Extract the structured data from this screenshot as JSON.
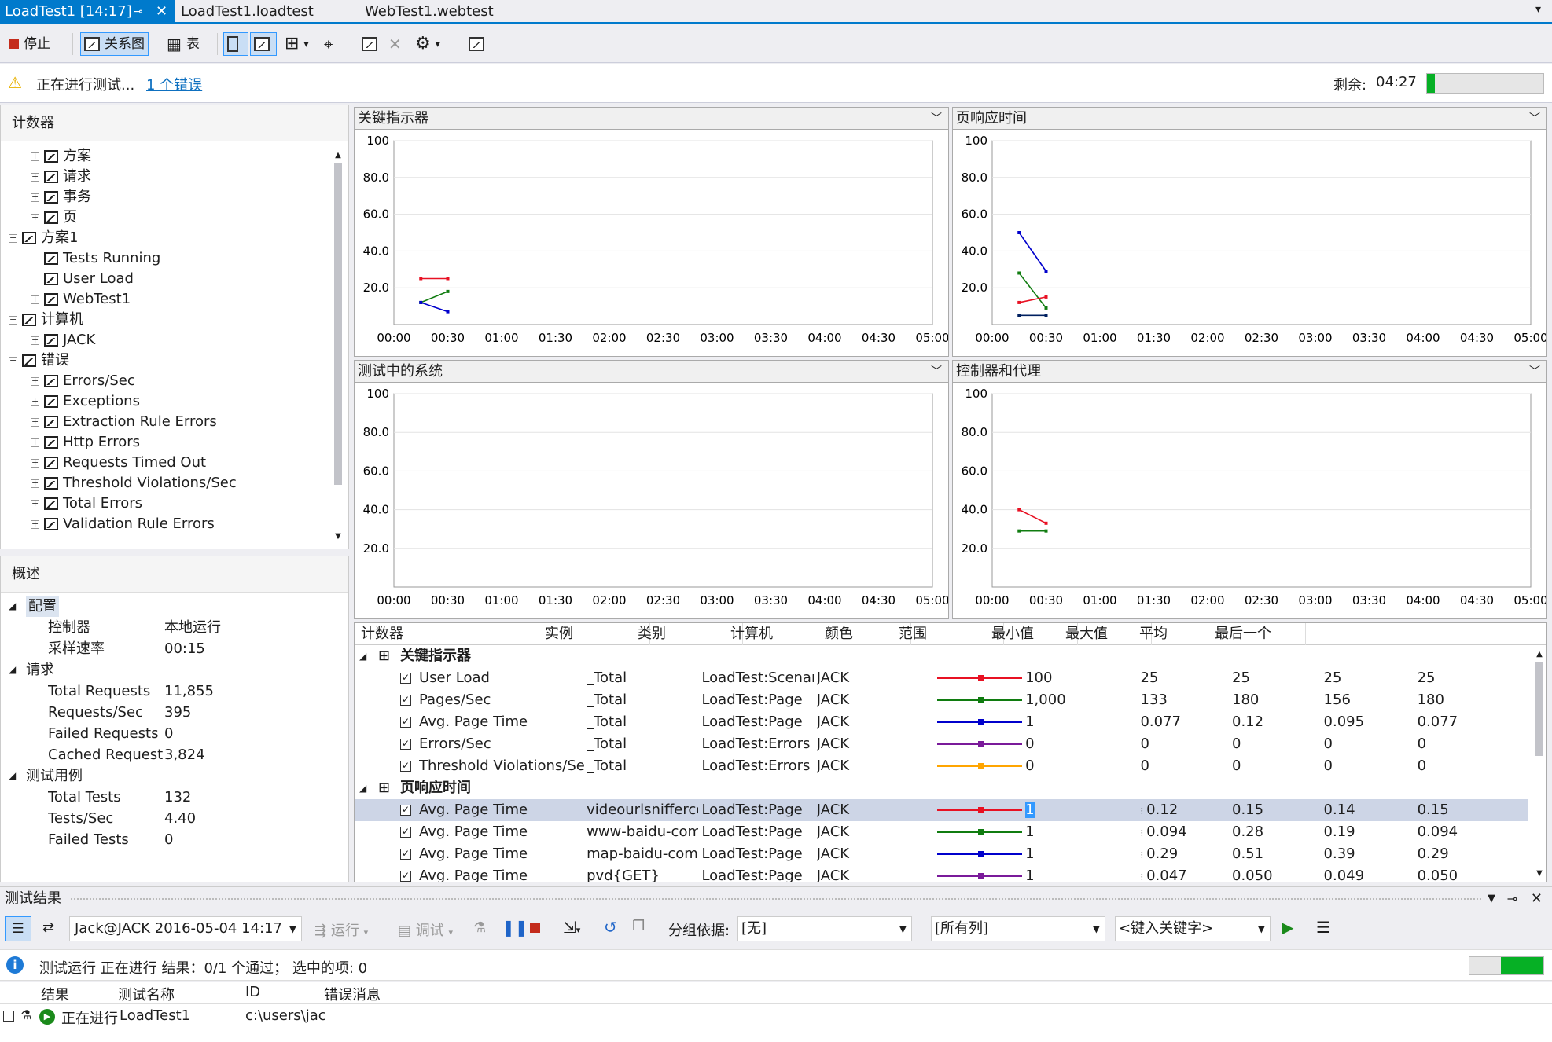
{
  "tabs": [
    {
      "label": "LoadTest1 [14:17]"
    },
    {
      "label": "LoadTest1.loadtest"
    },
    {
      "label": "WebTest1.webtest"
    }
  ],
  "toolbar": {
    "stop_label": "停止",
    "graph_label": "关系图",
    "table_label": "表"
  },
  "status": {
    "running_text": "正在进行测试...",
    "errors_link": "1 个错误",
    "remaining_label": "剩余:",
    "remaining_value": "04:27",
    "progress": 0.07
  },
  "counters": {
    "title": "计数器",
    "items": [
      {
        "label": "方案",
        "level": 1,
        "expander": "plus"
      },
      {
        "label": "请求",
        "level": 1,
        "expander": "plus"
      },
      {
        "label": "事务",
        "level": 1,
        "expander": "plus"
      },
      {
        "label": "页",
        "level": 1,
        "expander": "plus"
      },
      {
        "label": "方案1",
        "level": 0,
        "expander": "minus"
      },
      {
        "label": "Tests Running",
        "level": 1,
        "expander": "none"
      },
      {
        "label": "User Load",
        "level": 1,
        "expander": "none"
      },
      {
        "label": "WebTest1",
        "level": 1,
        "expander": "plus"
      },
      {
        "label": "计算机",
        "level": 0,
        "expander": "minus"
      },
      {
        "label": "JACK",
        "level": 1,
        "expander": "plus"
      },
      {
        "label": "错误",
        "level": 0,
        "expander": "minus"
      },
      {
        "label": "Errors/Sec",
        "level": 1,
        "expander": "plus"
      },
      {
        "label": "Exceptions",
        "level": 1,
        "expander": "plus"
      },
      {
        "label": "Extraction Rule Errors",
        "level": 1,
        "expander": "plus"
      },
      {
        "label": "Http Errors",
        "level": 1,
        "expander": "plus"
      },
      {
        "label": "Requests Timed Out",
        "level": 1,
        "expander": "plus"
      },
      {
        "label": "Threshold Violations/Sec",
        "level": 1,
        "expander": "plus"
      },
      {
        "label": "Total Errors",
        "level": 1,
        "expander": "plus"
      },
      {
        "label": "Validation Rule Errors",
        "level": 1,
        "expander": "plus"
      }
    ]
  },
  "overview": {
    "title": "概述",
    "rows": [
      {
        "type": "group",
        "label": "配置"
      },
      {
        "type": "item",
        "label": "控制器",
        "value": "本地运行"
      },
      {
        "type": "item",
        "label": "采样速率",
        "value": "00:15"
      },
      {
        "type": "group",
        "label": "请求"
      },
      {
        "type": "item",
        "label": "Total Requests",
        "value": "11,855"
      },
      {
        "type": "item",
        "label": "Requests/Sec",
        "value": "395"
      },
      {
        "type": "item",
        "label": "Failed Requests",
        "value": "0"
      },
      {
        "type": "item",
        "label": "Cached Requests",
        "value": "3,824"
      },
      {
        "type": "group",
        "label": "测试用例"
      },
      {
        "type": "item",
        "label": "Total Tests",
        "value": "132"
      },
      {
        "type": "item",
        "label": "Tests/Sec",
        "value": "4.40"
      },
      {
        "type": "item",
        "label": "Failed Tests",
        "value": "0"
      }
    ]
  },
  "chart_data": [
    {
      "type": "line",
      "title": "关键指示器",
      "ylim": [
        0,
        100
      ],
      "yticks": [
        "100",
        "80.0",
        "60.0",
        "40.0",
        "20.0"
      ],
      "x": [
        "00:00",
        "00:30",
        "01:00",
        "01:30",
        "02:00",
        "02:30",
        "03:00",
        "03:30",
        "04:00",
        "04:30",
        "05:00"
      ],
      "series": [
        {
          "color": "#e81123",
          "points": [
            [
              15,
              25
            ],
            [
              30,
              25
            ]
          ]
        },
        {
          "color": "#107c10",
          "points": [
            [
              15,
              12
            ],
            [
              30,
              18
            ]
          ]
        },
        {
          "color": "#0000cc",
          "points": [
            [
              15,
              12
            ],
            [
              30,
              7
            ]
          ]
        }
      ]
    },
    {
      "type": "line",
      "title": "页响应时间",
      "ylim": [
        0,
        100
      ],
      "yticks": [
        "100",
        "80.0",
        "60.0",
        "40.0",
        "20.0"
      ],
      "x": [
        "00:00",
        "00:30",
        "01:00",
        "01:30",
        "02:00",
        "02:30",
        "03:00",
        "03:30",
        "04:00",
        "04:30",
        "05:00"
      ],
      "series": [
        {
          "color": "#0000cc",
          "points": [
            [
              15,
              50
            ],
            [
              30,
              29
            ]
          ]
        },
        {
          "color": "#107c10",
          "points": [
            [
              15,
              28
            ],
            [
              30,
              9
            ]
          ]
        },
        {
          "color": "#e81123",
          "points": [
            [
              15,
              12
            ],
            [
              30,
              15
            ]
          ]
        },
        {
          "color": "#002060",
          "points": [
            [
              15,
              5
            ],
            [
              30,
              5
            ]
          ]
        }
      ]
    },
    {
      "type": "line",
      "title": "测试中的系统",
      "ylim": [
        0,
        100
      ],
      "yticks": [
        "100",
        "80.0",
        "60.0",
        "40.0",
        "20.0"
      ],
      "x": [
        "00:00",
        "00:30",
        "01:00",
        "01:30",
        "02:00",
        "02:30",
        "03:00",
        "03:30",
        "04:00",
        "04:30",
        "05:00"
      ],
      "series": []
    },
    {
      "type": "line",
      "title": "控制器和代理",
      "ylim": [
        0,
        100
      ],
      "yticks": [
        "100",
        "80.0",
        "60.0",
        "40.0",
        "20.0"
      ],
      "x": [
        "00:00",
        "00:30",
        "01:00",
        "01:30",
        "02:00",
        "02:30",
        "03:00",
        "03:30",
        "04:00",
        "04:30",
        "05:00"
      ],
      "series": [
        {
          "color": "#e81123",
          "points": [
            [
              15,
              40
            ],
            [
              30,
              33
            ]
          ]
        },
        {
          "color": "#107c10",
          "points": [
            [
              15,
              29
            ],
            [
              30,
              29
            ]
          ]
        }
      ]
    }
  ],
  "grid": {
    "headers": [
      "计数器",
      "实例",
      "类别",
      "计算机",
      "颜色",
      "范围",
      "最小值",
      "最大值",
      "平均",
      "最后一个"
    ],
    "groups": [
      {
        "title": "关键指示器",
        "rows": [
          {
            "counter": "User Load",
            "instance": "_Total",
            "category": "LoadTest:Scenario",
            "computer": "JACK",
            "color": "#e81123",
            "range": "100",
            "min": "25",
            "max": "25",
            "avg": "25",
            "last": "25"
          },
          {
            "counter": "Pages/Sec",
            "instance": "_Total",
            "category": "LoadTest:Page",
            "computer": "JACK",
            "color": "#107c10",
            "range": "1,000",
            "min": "133",
            "max": "180",
            "avg": "156",
            "last": "180"
          },
          {
            "counter": "Avg. Page Time",
            "instance": "_Total",
            "category": "LoadTest:Page",
            "computer": "JACK",
            "color": "#0000cc",
            "range": "1",
            "min": "0.077",
            "max": "0.12",
            "avg": "0.095",
            "last": "0.077"
          },
          {
            "counter": "Errors/Sec",
            "instance": "_Total",
            "category": "LoadTest:Errors",
            "computer": "JACK",
            "color": "#7a1a9a",
            "range": "0",
            "min": "0",
            "max": "0",
            "avg": "0",
            "last": "0"
          },
          {
            "counter": "Threshold Violations/Sec",
            "instance": "_Total",
            "category": "LoadTest:Errors",
            "computer": "JACK",
            "color": "#ffa500",
            "range": "0",
            "min": "0",
            "max": "0",
            "avg": "0",
            "last": "0"
          }
        ]
      },
      {
        "title": "页响应时间",
        "rows": [
          {
            "counter": "Avg. Page Time",
            "instance": "videourlsniffercom",
            "category": "LoadTest:Page",
            "computer": "JACK",
            "color": "#e81123",
            "range": "1",
            "min": "0.12",
            "max": "0.15",
            "avg": "0.14",
            "last": "0.15",
            "selected": true
          },
          {
            "counter": "Avg. Page Time",
            "instance": "www-baidu-com",
            "category": "LoadTest:Page",
            "computer": "JACK",
            "color": "#107c10",
            "range": "1",
            "min": "0.094",
            "max": "0.28",
            "avg": "0.19",
            "last": "0.094"
          },
          {
            "counter": "Avg. Page Time",
            "instance": "map-baidu-com",
            "category": "LoadTest:Page",
            "computer": "JACK",
            "color": "#0000cc",
            "range": "1",
            "min": "0.29",
            "max": "0.51",
            "avg": "0.39",
            "last": "0.29"
          },
          {
            "counter": "Avg. Page Time",
            "instance": "pvd{GET}",
            "category": "LoadTest:Page",
            "computer": "JACK",
            "color": "#7a1a9a",
            "range": "1",
            "min": "0.047",
            "max": "0.050",
            "avg": "0.049",
            "last": "0.050"
          }
        ]
      }
    ]
  },
  "results": {
    "title": "测试结果",
    "run_selector": "Jack@JACK 2016-05-04 14:17",
    "run_label": "运行",
    "debug_label": "调试",
    "group_by_label": "分组依据:",
    "group_by_value": "[无]",
    "columns_value": "[所有列]",
    "keyword_placeholder": "<键入关键字>",
    "info_text": "测试运行 正在进行  结果：0/1 个通过；  选中的项: 0",
    "headers": [
      "结果",
      "测试名称",
      "ID",
      "错误消息"
    ],
    "rows": [
      {
        "result": "正在进行",
        "name": "LoadTest1",
        "id": "c:\\users\\jac",
        "error": ""
      }
    ]
  }
}
